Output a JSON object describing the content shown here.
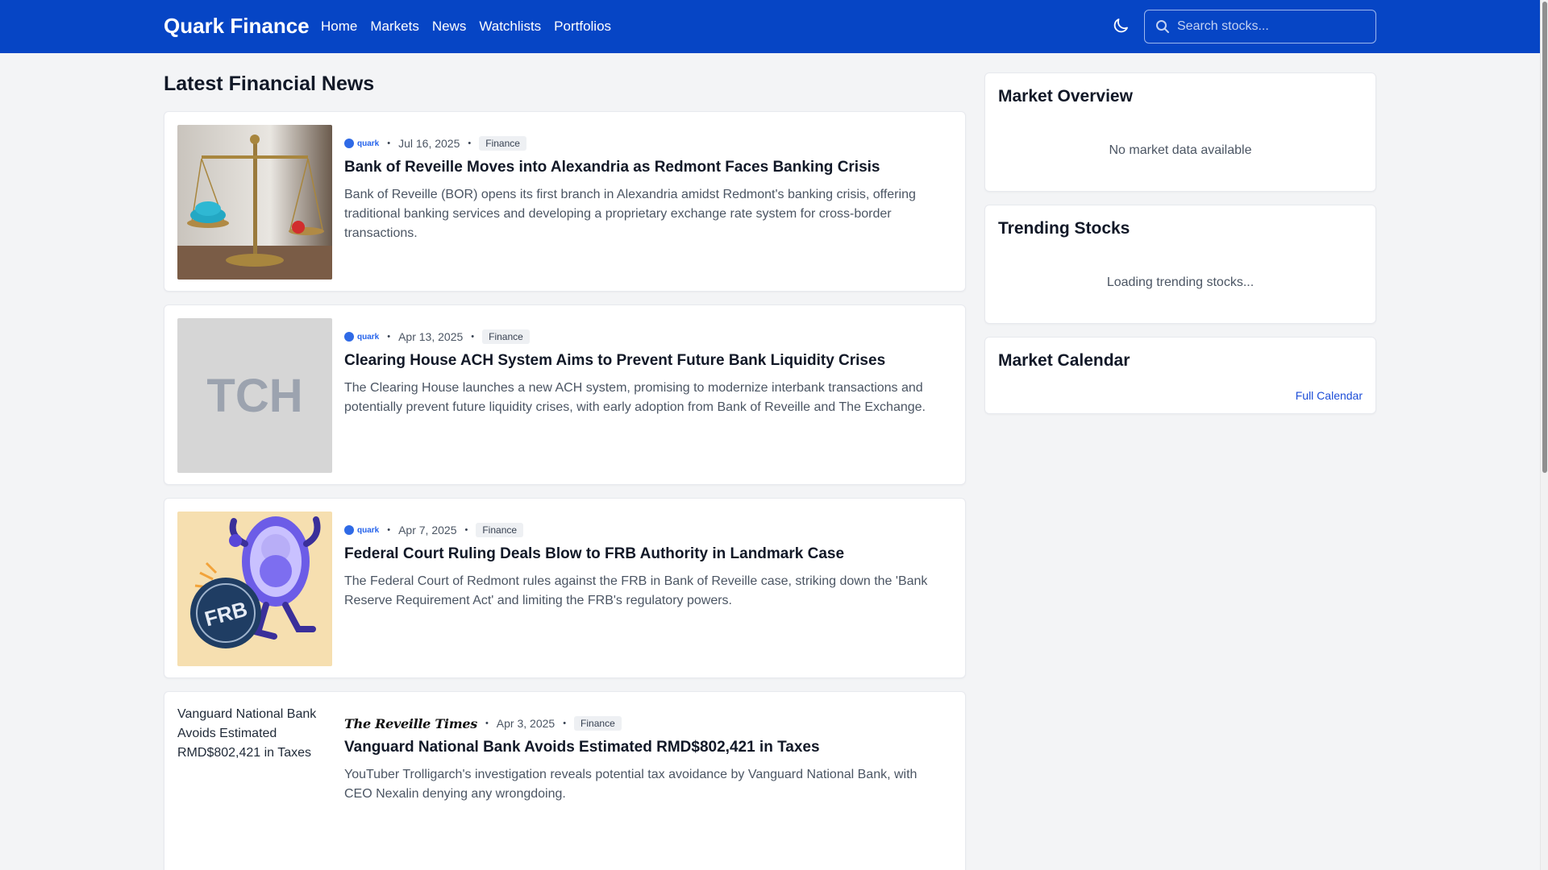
{
  "header": {
    "brand": "Quark Finance",
    "nav": [
      "Home",
      "Markets",
      "News",
      "Watchlists",
      "Portfolios"
    ],
    "search_placeholder": "Search stocks...",
    "colors": {
      "header_bg": "#0645c5",
      "accent": "#2563eb"
    }
  },
  "main": {
    "title": "Latest Financial News",
    "articles": [
      {
        "source": "quark",
        "date": "Jul 16, 2025",
        "category": "Finance",
        "title": "Bank of Reveille Moves into Alexandria as Redmont Faces Banking Crisis",
        "summary": "Bank of Reveille (BOR) opens its first branch in Alexandria amidst Redmont's banking crisis, offering traditional banking services and developing a proprietary exchange rate system for cross-border transactions."
      },
      {
        "source": "quark",
        "date": "Apr 13, 2025",
        "category": "Finance",
        "title": "Clearing House ACH System Aims to Prevent Future Bank Liquidity Crises",
        "summary": "The Clearing House launches a new ACH system, promising to modernize interbank transactions and potentially prevent future liquidity crises, with early adoption from Bank of Reveille and The Exchange.",
        "image_text": "TCH"
      },
      {
        "source": "quark",
        "date": "Apr 7, 2025",
        "category": "Finance",
        "title": "Federal Court Ruling Deals Blow to FRB Authority in Landmark Case",
        "summary": "The Federal Court of Redmont rules against the FRB in Bank of Reveille case, striking down the 'Bank Reserve Requirement Act' and limiting the FRB's regulatory powers.",
        "image_text": "FRB"
      },
      {
        "source": "The Reveille Times",
        "date": "Apr 3, 2025",
        "category": "Finance",
        "title": "Vanguard National Bank Avoids Estimated RMD$802,421 in Taxes",
        "summary": "YouTuber Trolligarch's investigation reveals potential tax avoidance by Vanguard National Bank, with CEO Nexalin denying any wrongdoing.",
        "image_alt": "Vanguard National Bank Avoids Estimated RMD$802,421 in Taxes"
      }
    ]
  },
  "sidebar": {
    "market_overview": {
      "title": "Market Overview",
      "message": "No market data available"
    },
    "trending": {
      "title": "Trending Stocks",
      "message": "Loading trending stocks..."
    },
    "calendar": {
      "title": "Market Calendar",
      "link": "Full Calendar"
    }
  }
}
